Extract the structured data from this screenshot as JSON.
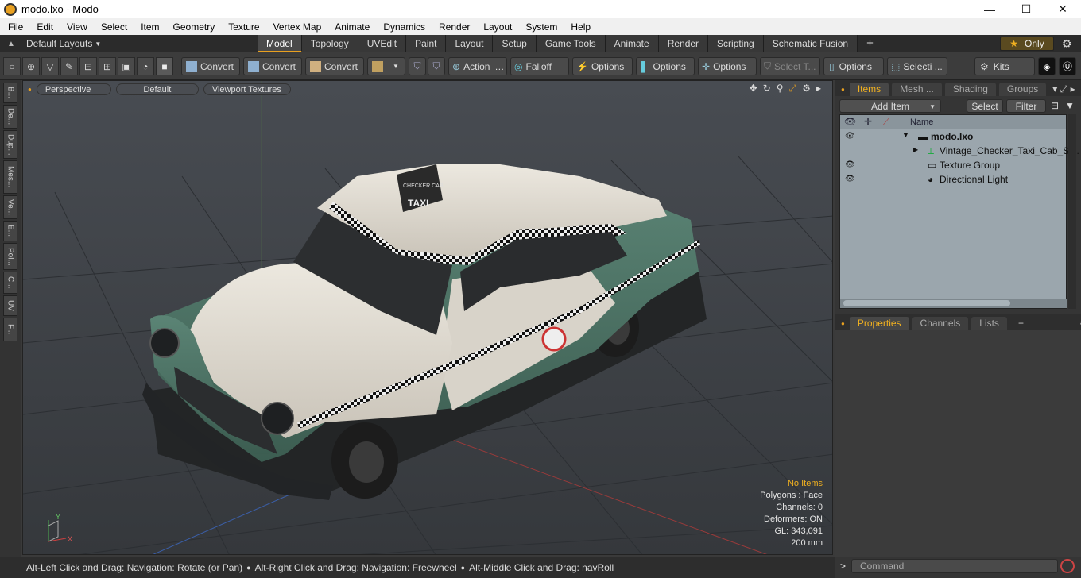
{
  "window": {
    "title": "modo.lxo - Modo",
    "min": "—",
    "max": "☐",
    "close": "✕"
  },
  "menu": [
    "File",
    "Edit",
    "View",
    "Select",
    "Item",
    "Geometry",
    "Texture",
    "Vertex Map",
    "Animate",
    "Dynamics",
    "Render",
    "Layout",
    "System",
    "Help"
  ],
  "layout": {
    "label": "Default Layouts",
    "tabs": [
      "Model",
      "Topology",
      "UVEdit",
      "Paint",
      "Layout",
      "Setup",
      "Game Tools",
      "Animate",
      "Render",
      "Scripting",
      "Schematic Fusion"
    ],
    "active": "Model",
    "plus": "+",
    "only": "Only"
  },
  "toolbar": {
    "convert1": "Convert",
    "convert2": "Convert",
    "convert3": "Convert",
    "action": "Action",
    "falloff": "Falloff",
    "options1": "Options",
    "options2": "Options",
    "options3": "Options",
    "select_t": "Select T...",
    "options4": "Options",
    "selecti": "Selecti ...",
    "kits": "Kits"
  },
  "lefttabs": [
    "B...",
    "De...",
    "Dup...",
    "Mes...",
    "Ve...",
    "E...",
    "Pol...",
    "C...",
    "UV",
    "F..."
  ],
  "viewport": {
    "perspective": "Perspective",
    "default": "Default",
    "textures": "Viewport Textures"
  },
  "stats": {
    "no_items": "No Items",
    "polygons": "Polygons : Face",
    "channels": "Channels: 0",
    "deformers": "Deformers: ON",
    "gl": "GL: 343,091",
    "size": "200 mm"
  },
  "status": {
    "hint1": "Alt-Left Click and Drag: Navigation: Rotate (or Pan)",
    "hint2": "Alt-Right Click and Drag: Navigation: Freewheel",
    "hint3": "Alt-Middle Click and Drag: navRoll"
  },
  "items_panel": {
    "tabs": [
      "Items",
      "Mesh ...",
      "Shading",
      "Groups"
    ],
    "add_item": "Add Item",
    "select": "Select",
    "filter": "Filter",
    "col_name": "Name",
    "rows": [
      "modo.lxo",
      "Vintage_Checker_Taxi_Cab_Si...",
      "Texture Group",
      "Directional Light"
    ]
  },
  "props_panel": {
    "tabs": [
      "Properties",
      "Channels",
      "Lists"
    ],
    "plus": "+"
  },
  "command": {
    "placeholder": "Command",
    "prompt": ">"
  },
  "taxi": {
    "sign_top": "CHECKER CAB",
    "sign_main": "TAXI"
  },
  "colors": {
    "accent": "#e8a020",
    "body_green": "#4e7668",
    "body_cream": "#ddd8cf"
  }
}
